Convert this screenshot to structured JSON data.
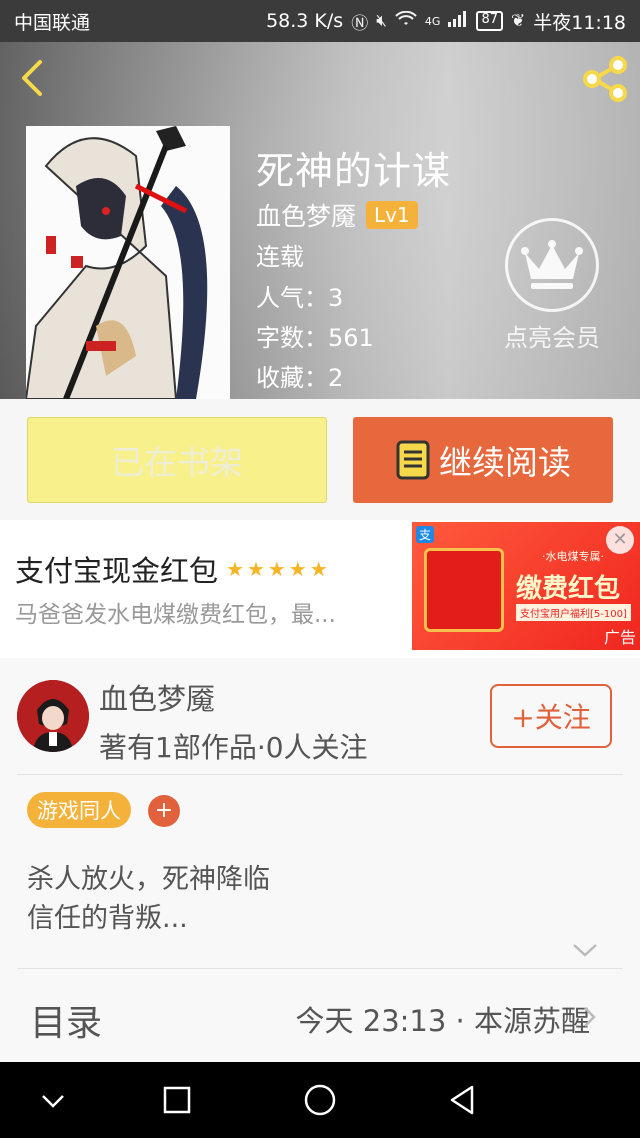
{
  "status_bar": {
    "carrier": "中国联通",
    "speed": "58.3 K/s",
    "network": "4G",
    "battery": "87",
    "time": "半夜11:18"
  },
  "header": {
    "back_icon": "chevron-left-icon",
    "share_icon": "share-icon",
    "title": "死神的计谋",
    "author": "血色梦魇",
    "level": "Lv1",
    "status": "连载",
    "popularity": "人气：3",
    "word_count": "字数：561",
    "favorites": "收藏：2",
    "vip_label": "点亮会员",
    "accent": "#f4b23a"
  },
  "actions": {
    "shelf_label": "已在书架",
    "read_label": "继续阅读",
    "read_color": "#e8683e",
    "shelf_color": "#f8f08a"
  },
  "ad": {
    "title": "支付宝现金红包",
    "stars": "★★★★★",
    "description": "马爸爸发水电煤缴费红包，最...",
    "image_headline": "缴费红包",
    "image_small": "·水电煤专属·",
    "image_sub": "支付宝用户福利[5-100]",
    "ad_mark": "广告",
    "close_icon": "close-icon"
  },
  "author_panel": {
    "name": "血色梦魇",
    "works": "著有1部作品·0人关注",
    "follow_label": "+关注",
    "tag": "游戏同人",
    "tag_add": "+",
    "description_line1": "杀人放火，死神降临",
    "description_line2": "信任的背叛...",
    "toc_label": "目录",
    "latest_chapter": "今天 23:13 · 本源苏醒"
  },
  "nav_bar": {
    "icons": [
      "chevron-down-icon",
      "square-icon",
      "circle-icon",
      "triangle-back-icon"
    ]
  }
}
